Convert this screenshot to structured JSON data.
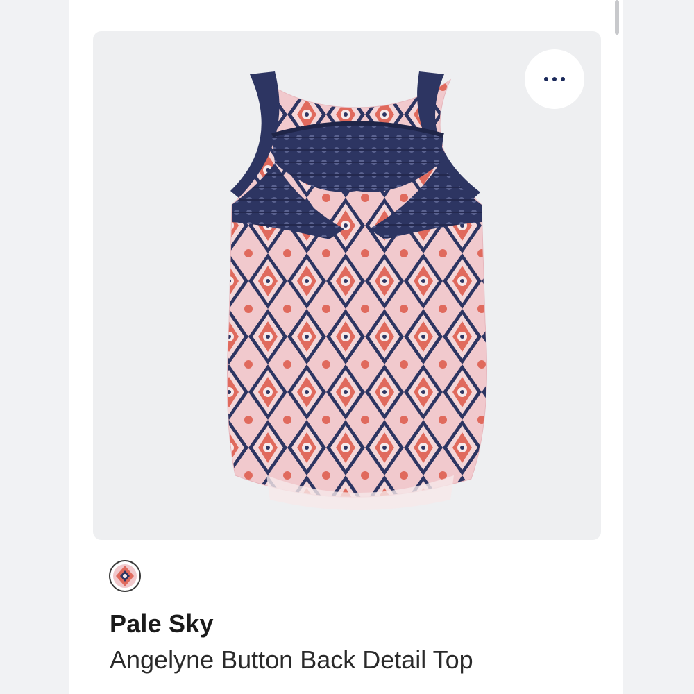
{
  "product": {
    "brand": "Pale Sky",
    "name": "Angelyne Button Back Detail Top"
  },
  "image": {
    "subject": "sleeveless printed top with navy crochet yoke",
    "card_background": "#eeeff1",
    "navy": "#2d3562",
    "coral": "#e06a5d",
    "blush": "#f1c9cd"
  },
  "actions": {
    "more_icon": "more-horizontal-icon"
  },
  "swatch": {
    "icon": "color-swatch-icon"
  }
}
